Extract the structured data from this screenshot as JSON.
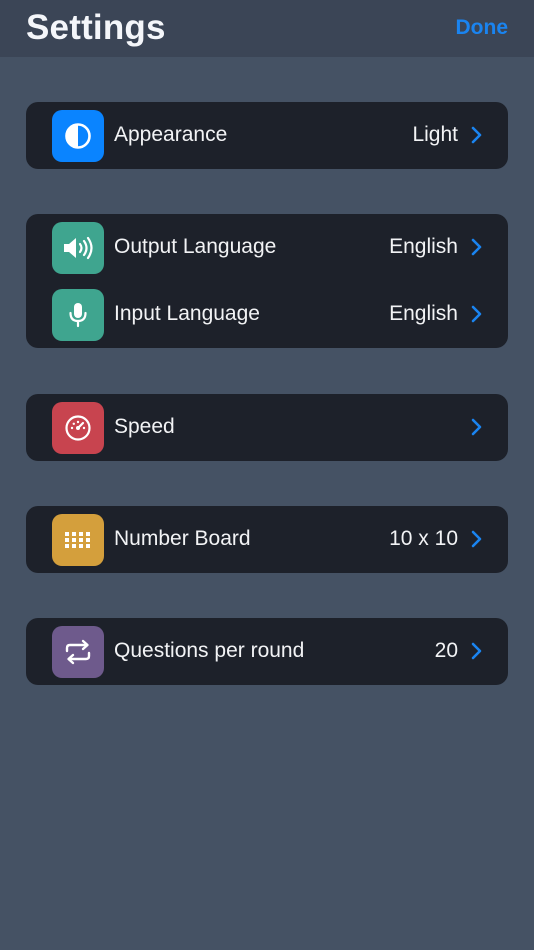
{
  "nav": {
    "title": "Settings",
    "done_label": "Done"
  },
  "colors": {
    "background": "#455264",
    "navbar": "#3b4556",
    "group": "#1d212a",
    "accent": "#1a84f0",
    "appearance_icon": "#0a84ff",
    "language_icon": "#3fa58f",
    "speed_icon": "#c8444f",
    "number_board_icon": "#d49f3c",
    "questions_icon": "#6e5a8c"
  },
  "rows": {
    "appearance": {
      "label": "Appearance",
      "value": "Light",
      "icon": "half-circle-icon"
    },
    "output_language": {
      "label": "Output Language",
      "value": "English",
      "icon": "speaker-icon"
    },
    "input_language": {
      "label": "Input Language",
      "value": "English",
      "icon": "microphone-icon"
    },
    "speed": {
      "label": "Speed",
      "value": "",
      "icon": "speedometer-icon"
    },
    "number_board": {
      "label": "Number Board",
      "value": "10 x 10",
      "icon": "grid-icon"
    },
    "questions_per_round": {
      "label": "Questions per round",
      "value": "20",
      "icon": "repeat-icon"
    }
  }
}
